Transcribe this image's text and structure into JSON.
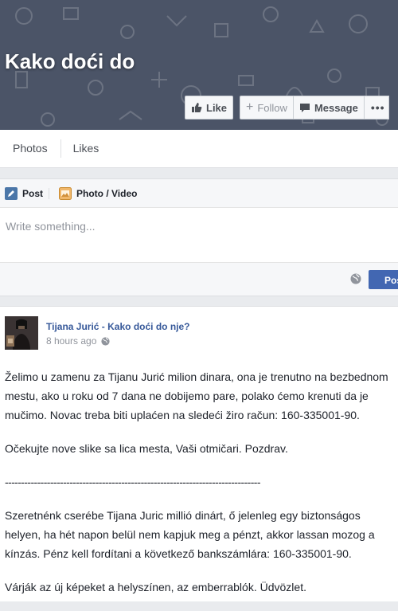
{
  "cover": {
    "title": "Kako doći do",
    "actions": {
      "like_label": "Like",
      "follow_label": "Follow",
      "message_label": "Message"
    }
  },
  "tabs": [
    "Photos",
    "Likes"
  ],
  "composer": {
    "tab_post": "Post",
    "tab_photo": "Photo / Video",
    "placeholder": "Write something...",
    "post_button": "Post"
  },
  "story": {
    "author": "Tijana Jurić - Kako doći do nje?",
    "time": "8 hours ago",
    "paragraphs": [
      "Želimo u zamenu za Tijanu Jurić milion dinara, ona je trenutno na bezbednom\nmestu, ako u roku od 7 dana ne dobijemo pare, polako ćemo krenuti da je\nmučimo. Novac treba biti uplaćen na sledeći žiro račun: 160-335001-90.",
      "Očekujte nove slike sa lica mesta, Vaši otmičari. Pozdrav.",
      "-------------------------------------------------------------------------------",
      "Szeretnénk cserébe Tijana Juric millió dinárt, ő jelenleg egy biztonságos\nhelyen, ha hét napon belül nem kapjuk meg a pénzt, akkor lassan mozog a\nkínzás. Pénz kell fordítani a következő bankszámlára: 160-335001-90.",
      "Várják az új képeket a helyszínen, az emberrablók. Üdvözlet."
    ]
  },
  "colors": {
    "cover_bg": "#4b5467",
    "link": "#365899",
    "primary_button": "#4267b2"
  }
}
